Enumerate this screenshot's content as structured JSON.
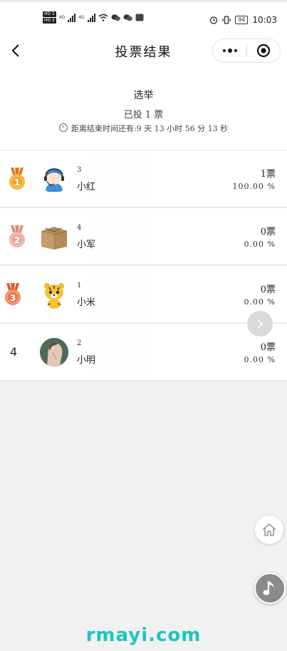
{
  "status_bar": {
    "sim1": "HD 1",
    "sim2": "HD 2",
    "net1": "4G",
    "net2": "4G",
    "battery": "94",
    "time": "10:03"
  },
  "navbar": {
    "title": "投票结果",
    "back_icon": "chevron-left-icon",
    "more_icon": "more-dots-icon",
    "close_icon": "target-circle-icon"
  },
  "summary": {
    "title": "选举",
    "votes_cast": "已投 1 票",
    "deadline": "距离结束时间还有:9 天 13 小时 56 分 13 秒"
  },
  "results": [
    {
      "rank": "1",
      "rank_type": "gold-medal",
      "id": "3",
      "name": "小红",
      "votes": "1票",
      "percent": "100.00 %",
      "avatar": "headset-girl-avatar"
    },
    {
      "rank": "2",
      "rank_type": "silver-medal",
      "id": "4",
      "name": "小军",
      "votes": "0票",
      "percent": "0.00 %",
      "avatar": "cardboard-box-avatar"
    },
    {
      "rank": "3",
      "rank_type": "bronze-medal",
      "id": "1",
      "name": "小米",
      "votes": "0票",
      "percent": "0.00 %",
      "avatar": "tiger-avatar"
    },
    {
      "rank": "4",
      "rank_type": "number",
      "id": "2",
      "name": "小明",
      "votes": "0票",
      "percent": "0.00 %",
      "avatar": "portrait-avatar"
    }
  ],
  "floating": {
    "arrow_icon": "chevron-right-icon",
    "home_icon": "home-icon",
    "music_icon": "music-note-icon"
  },
  "watermark": "rmayi.com",
  "colors": {
    "gold": "#f0a32c",
    "silver": "#e3a49b",
    "bronze": "#e6744a",
    "watermark": "#19c7c0",
    "background": "#f1f1f1"
  }
}
